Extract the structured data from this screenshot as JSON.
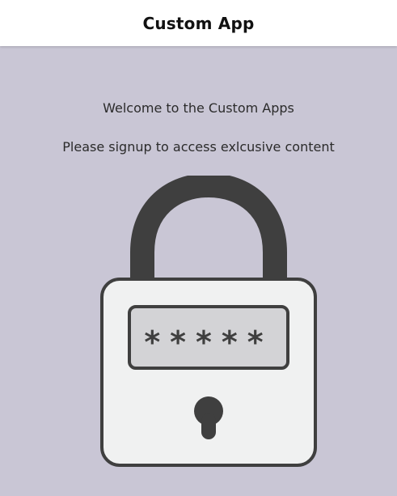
{
  "header": {
    "title": "Custom App"
  },
  "main": {
    "welcome": "Welcome to the Custom Apps",
    "subtitle": "Please signup to access exlcusive content",
    "illustration": {
      "icon": "padlock-icon",
      "masked_password": "*****"
    }
  },
  "colors": {
    "background": "#c9c6d5",
    "header": "#ffffff",
    "lock_dark": "#3f3f3f",
    "lock_body": "#f0f1f1",
    "password_field": "#d3d3d6"
  }
}
